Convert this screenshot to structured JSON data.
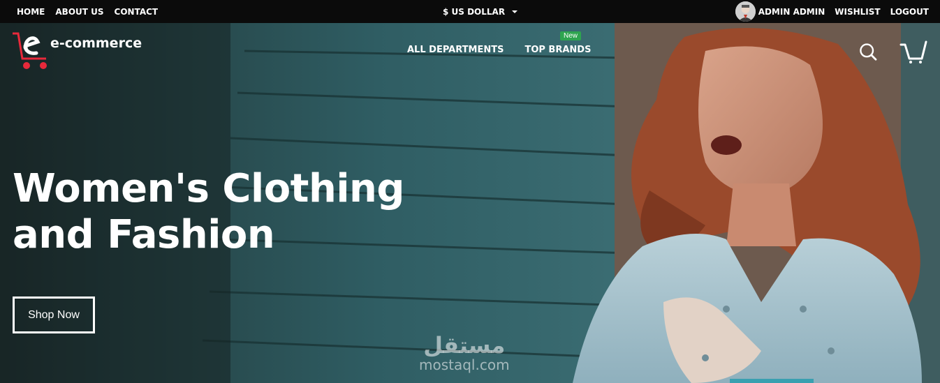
{
  "topbar": {
    "links": [
      "HOME",
      "ABOUT US",
      "CONTACT"
    ],
    "currency": "$ US DOLLAR",
    "user_name": "ADMIN ADMIN",
    "wishlist": "WISHLIST",
    "logout": "LOGOUT"
  },
  "logo": {
    "text": "e-commerce",
    "accent": "#e8293b"
  },
  "nav": {
    "items": [
      "ALL DEPARTMENTS",
      "TOP BRANDS"
    ],
    "badge": "New",
    "badge_color": "#2ea44f"
  },
  "hero": {
    "headline_line1": "Women's Clothing",
    "headline_line2": "and Fashion",
    "cta": "Shop Now"
  },
  "icons": {
    "search": "search-icon",
    "cart": "cart-icon"
  },
  "watermark": {
    "arabic": "مستقل",
    "latin": "mostaql.com"
  }
}
